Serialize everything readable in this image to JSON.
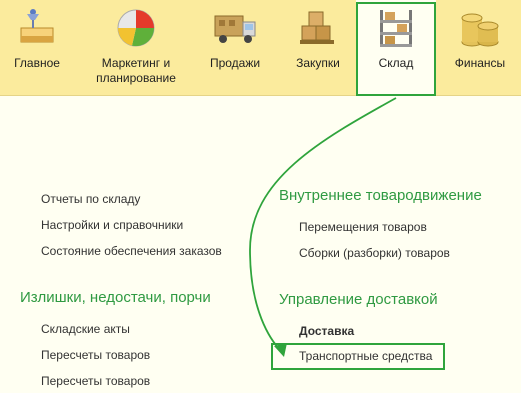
{
  "sections": [
    {
      "label": "Главное",
      "icon": "home-icon"
    },
    {
      "label": "Маркетинг и\nпланирование",
      "icon": "pie-chart-icon"
    },
    {
      "label": "Продажи",
      "icon": "delivery-truck-icon"
    },
    {
      "label": "Закупки",
      "icon": "cargo-boxes-icon"
    },
    {
      "label": "Склад",
      "icon": "warehouse-shelves-icon"
    },
    {
      "label": "Финансы",
      "icon": "coins-icon"
    }
  ],
  "left_column": {
    "links_top": [
      "Отчеты по складу",
      "Настройки и справочники",
      "Состояние обеспечения заказов"
    ],
    "group_title": "Излишки, недостачи, порчи",
    "links_bottom": [
      "Складские акты",
      "Пересчеты товаров",
      "Пересчеты товаров"
    ]
  },
  "right_column": {
    "group1_title": "Внутреннее товародвижение",
    "group1_links": [
      "Перемещения товаров",
      "Сборки (разборки) товаров"
    ],
    "group2_title": "Управление доставкой",
    "group2_links": [
      "Доставка",
      "Транспортные средства"
    ]
  },
  "colors": {
    "topbar": "#fbeb9d",
    "background": "#fffff2",
    "accent_green": "#2fa43c",
    "group_title": "#2f9a42"
  }
}
